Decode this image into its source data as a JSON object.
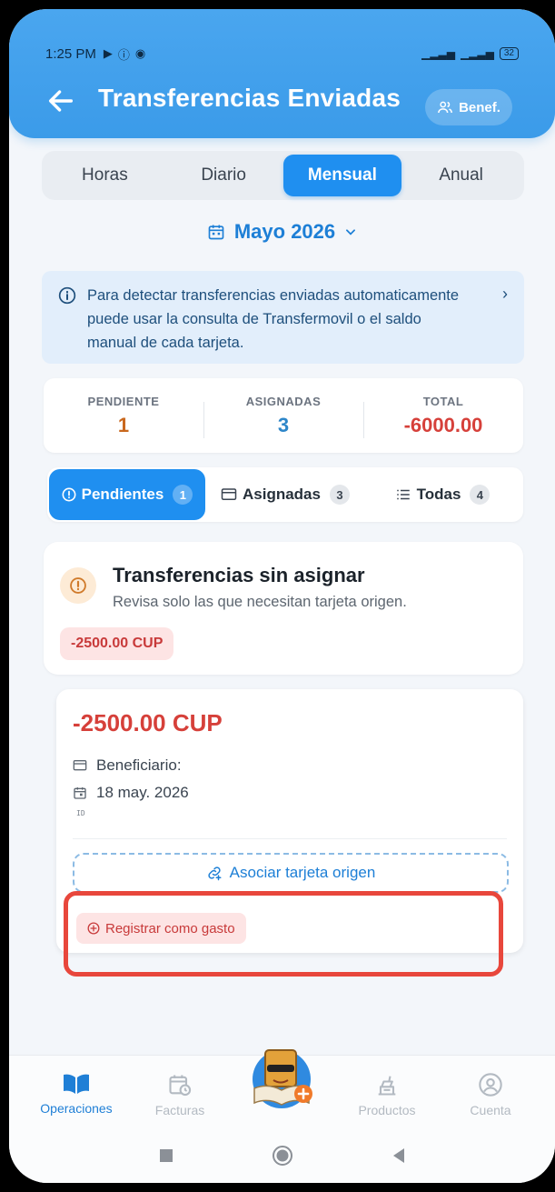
{
  "status_bar": {
    "time": "1:25 PM",
    "battery": "32"
  },
  "header": {
    "title": "Transferencias Enviadas",
    "benef_label": "Benef."
  },
  "segments": [
    "Horas",
    "Diario",
    "Mensual",
    "Anual"
  ],
  "active_segment": "Mensual",
  "period": {
    "label": "Mayo 2026"
  },
  "info_banner": {
    "text": "Para detectar transferencias enviadas automaticamente puede usar la consulta de Transfermovil o el saldo manual de cada tarjeta."
  },
  "stats": [
    {
      "label": "PENDIENTE",
      "value": "1",
      "color": "#c9681e"
    },
    {
      "label": "ASIGNADAS",
      "value": "3",
      "color": "#2d86c9"
    },
    {
      "label": "TOTAL",
      "value": "-6000.00",
      "color": "#d6403a"
    }
  ],
  "filter_tabs": [
    {
      "label": "Pendientes",
      "count": "1",
      "active": true
    },
    {
      "label": "Asignadas",
      "count": "3",
      "active": false
    },
    {
      "label": "Todas",
      "count": "4",
      "active": false
    }
  ],
  "unassigned_card": {
    "title": "Transferencias sin asignar",
    "subtitle": "Revisa solo las que necesitan tarjeta origen.",
    "amount_pill": "-2500.00 CUP"
  },
  "transfer": {
    "amount": "-2500.00 CUP",
    "beneficiary_label": "Beneficiario:",
    "date": "18 may. 2026",
    "id_label": "ID",
    "associate_label": "Asociar tarjeta origen",
    "register_label": "Registrar como gasto"
  },
  "bottom_nav": [
    {
      "label": "Operaciones",
      "active": true
    },
    {
      "label": "Facturas",
      "active": false
    },
    {
      "label": "Productos",
      "active": false
    },
    {
      "label": "Cuenta",
      "active": false
    }
  ],
  "colors": {
    "primary": "#1f8ff0",
    "header": "#3b9be9",
    "danger": "#d6403a",
    "highlight": "#e8473c"
  }
}
